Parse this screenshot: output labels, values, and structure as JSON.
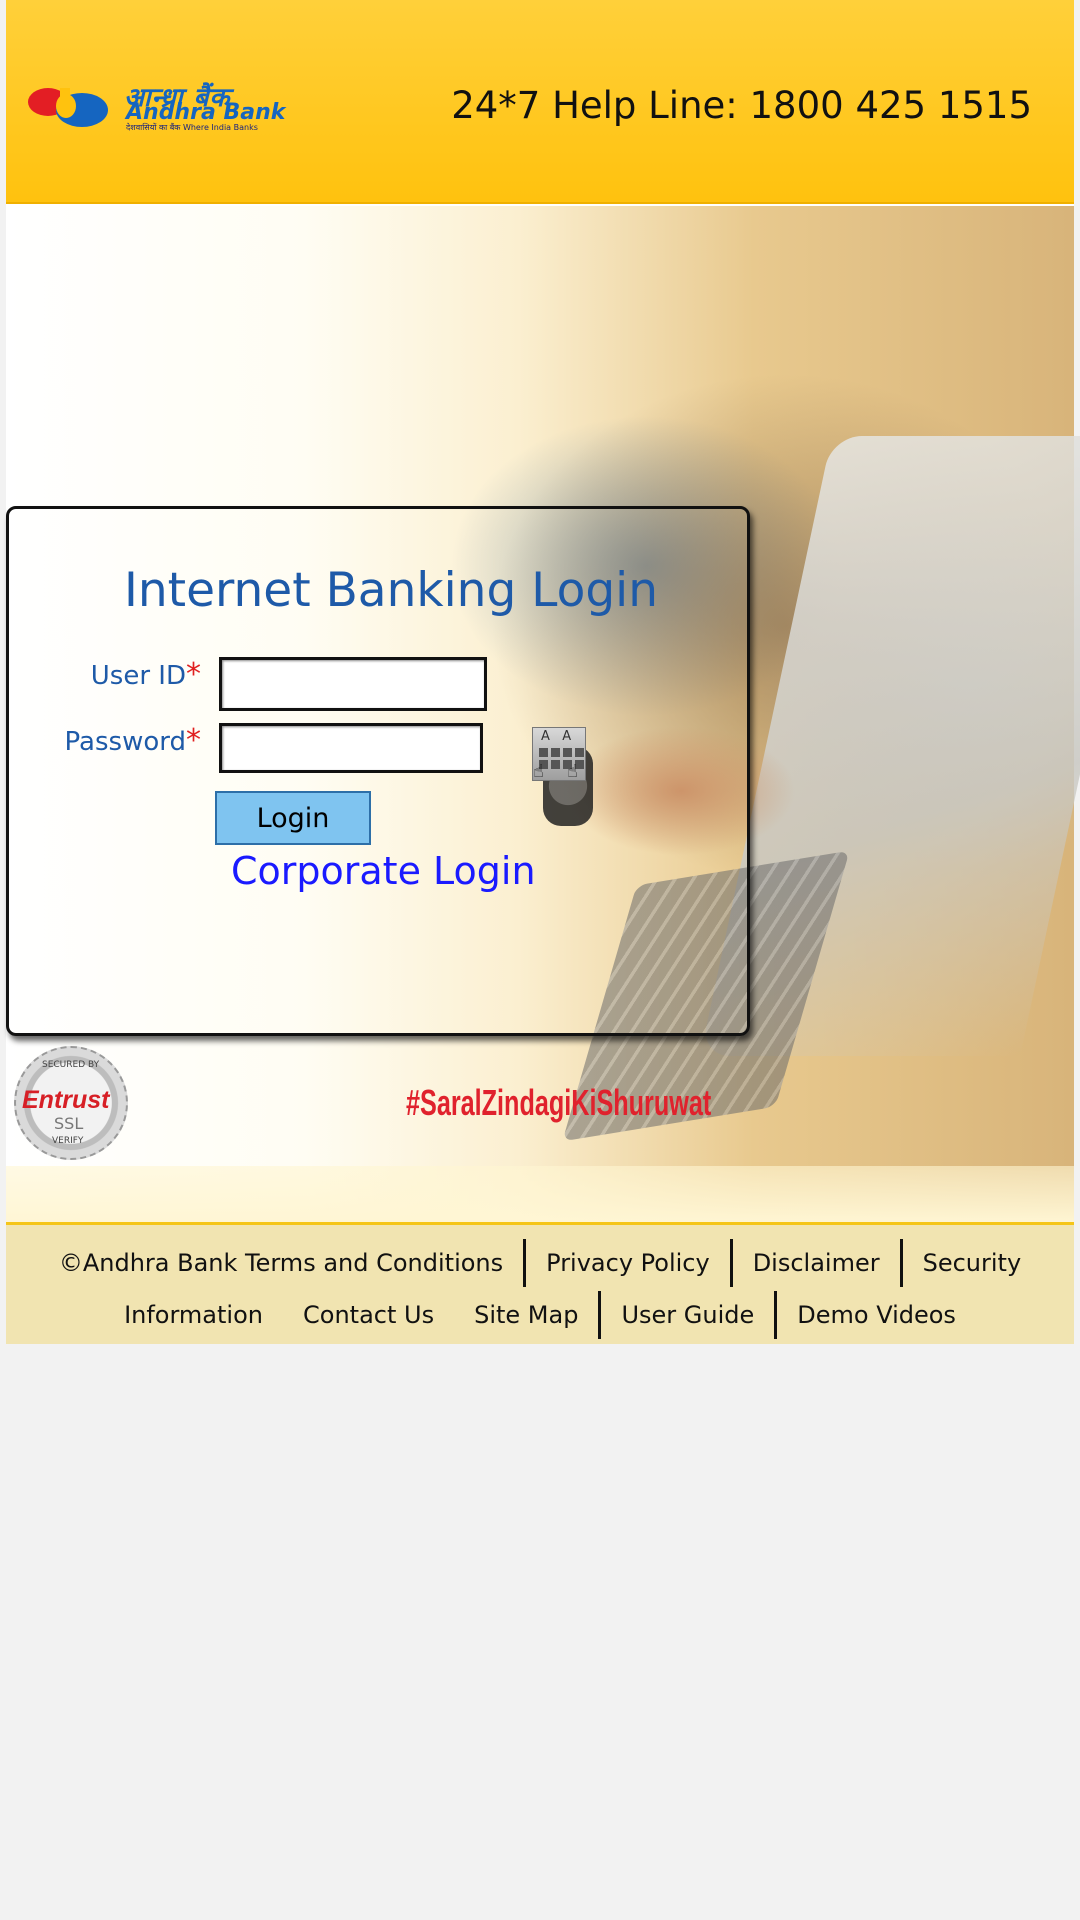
{
  "header": {
    "logo": {
      "hindi": "आन्ध्रा बैंक",
      "english": "Andhra Bank",
      "tagline": "देशवासियों का बैंक   Where India Banks"
    },
    "helpline": "24*7 Help Line: 1800 425 1515"
  },
  "login": {
    "title": "Internet Banking Login",
    "user_label": "User ID",
    "password_label": "Password",
    "required_mark": "*",
    "user_value": "",
    "password_value": "",
    "login_button": "Login",
    "corporate_link": "Corporate Login",
    "virtual_keyboard_icon": "virtual-keyboard-icon"
  },
  "badges": {
    "seal_top": "SECURED BY",
    "seal_brand": "Entrust",
    "seal_ssl": "SSL",
    "seal_bottom": "VERIFY",
    "hashtag": "#SaralZindagiKiShuruwat"
  },
  "footer": {
    "row1": [
      "©Andhra Bank Terms and Conditions",
      "Privacy Policy",
      "Disclaimer",
      "Security"
    ],
    "row2": [
      "Information",
      "Contact Us",
      "Site Map",
      "User Guide",
      "Demo Videos"
    ]
  },
  "colors": {
    "header_bg": "#ffc20e",
    "title_blue": "#1e5aa8",
    "required_red": "#e02020",
    "link_blue": "#1a1aff",
    "button_bg": "#7fc4f0",
    "footer_bg": "#f1e4b1"
  }
}
